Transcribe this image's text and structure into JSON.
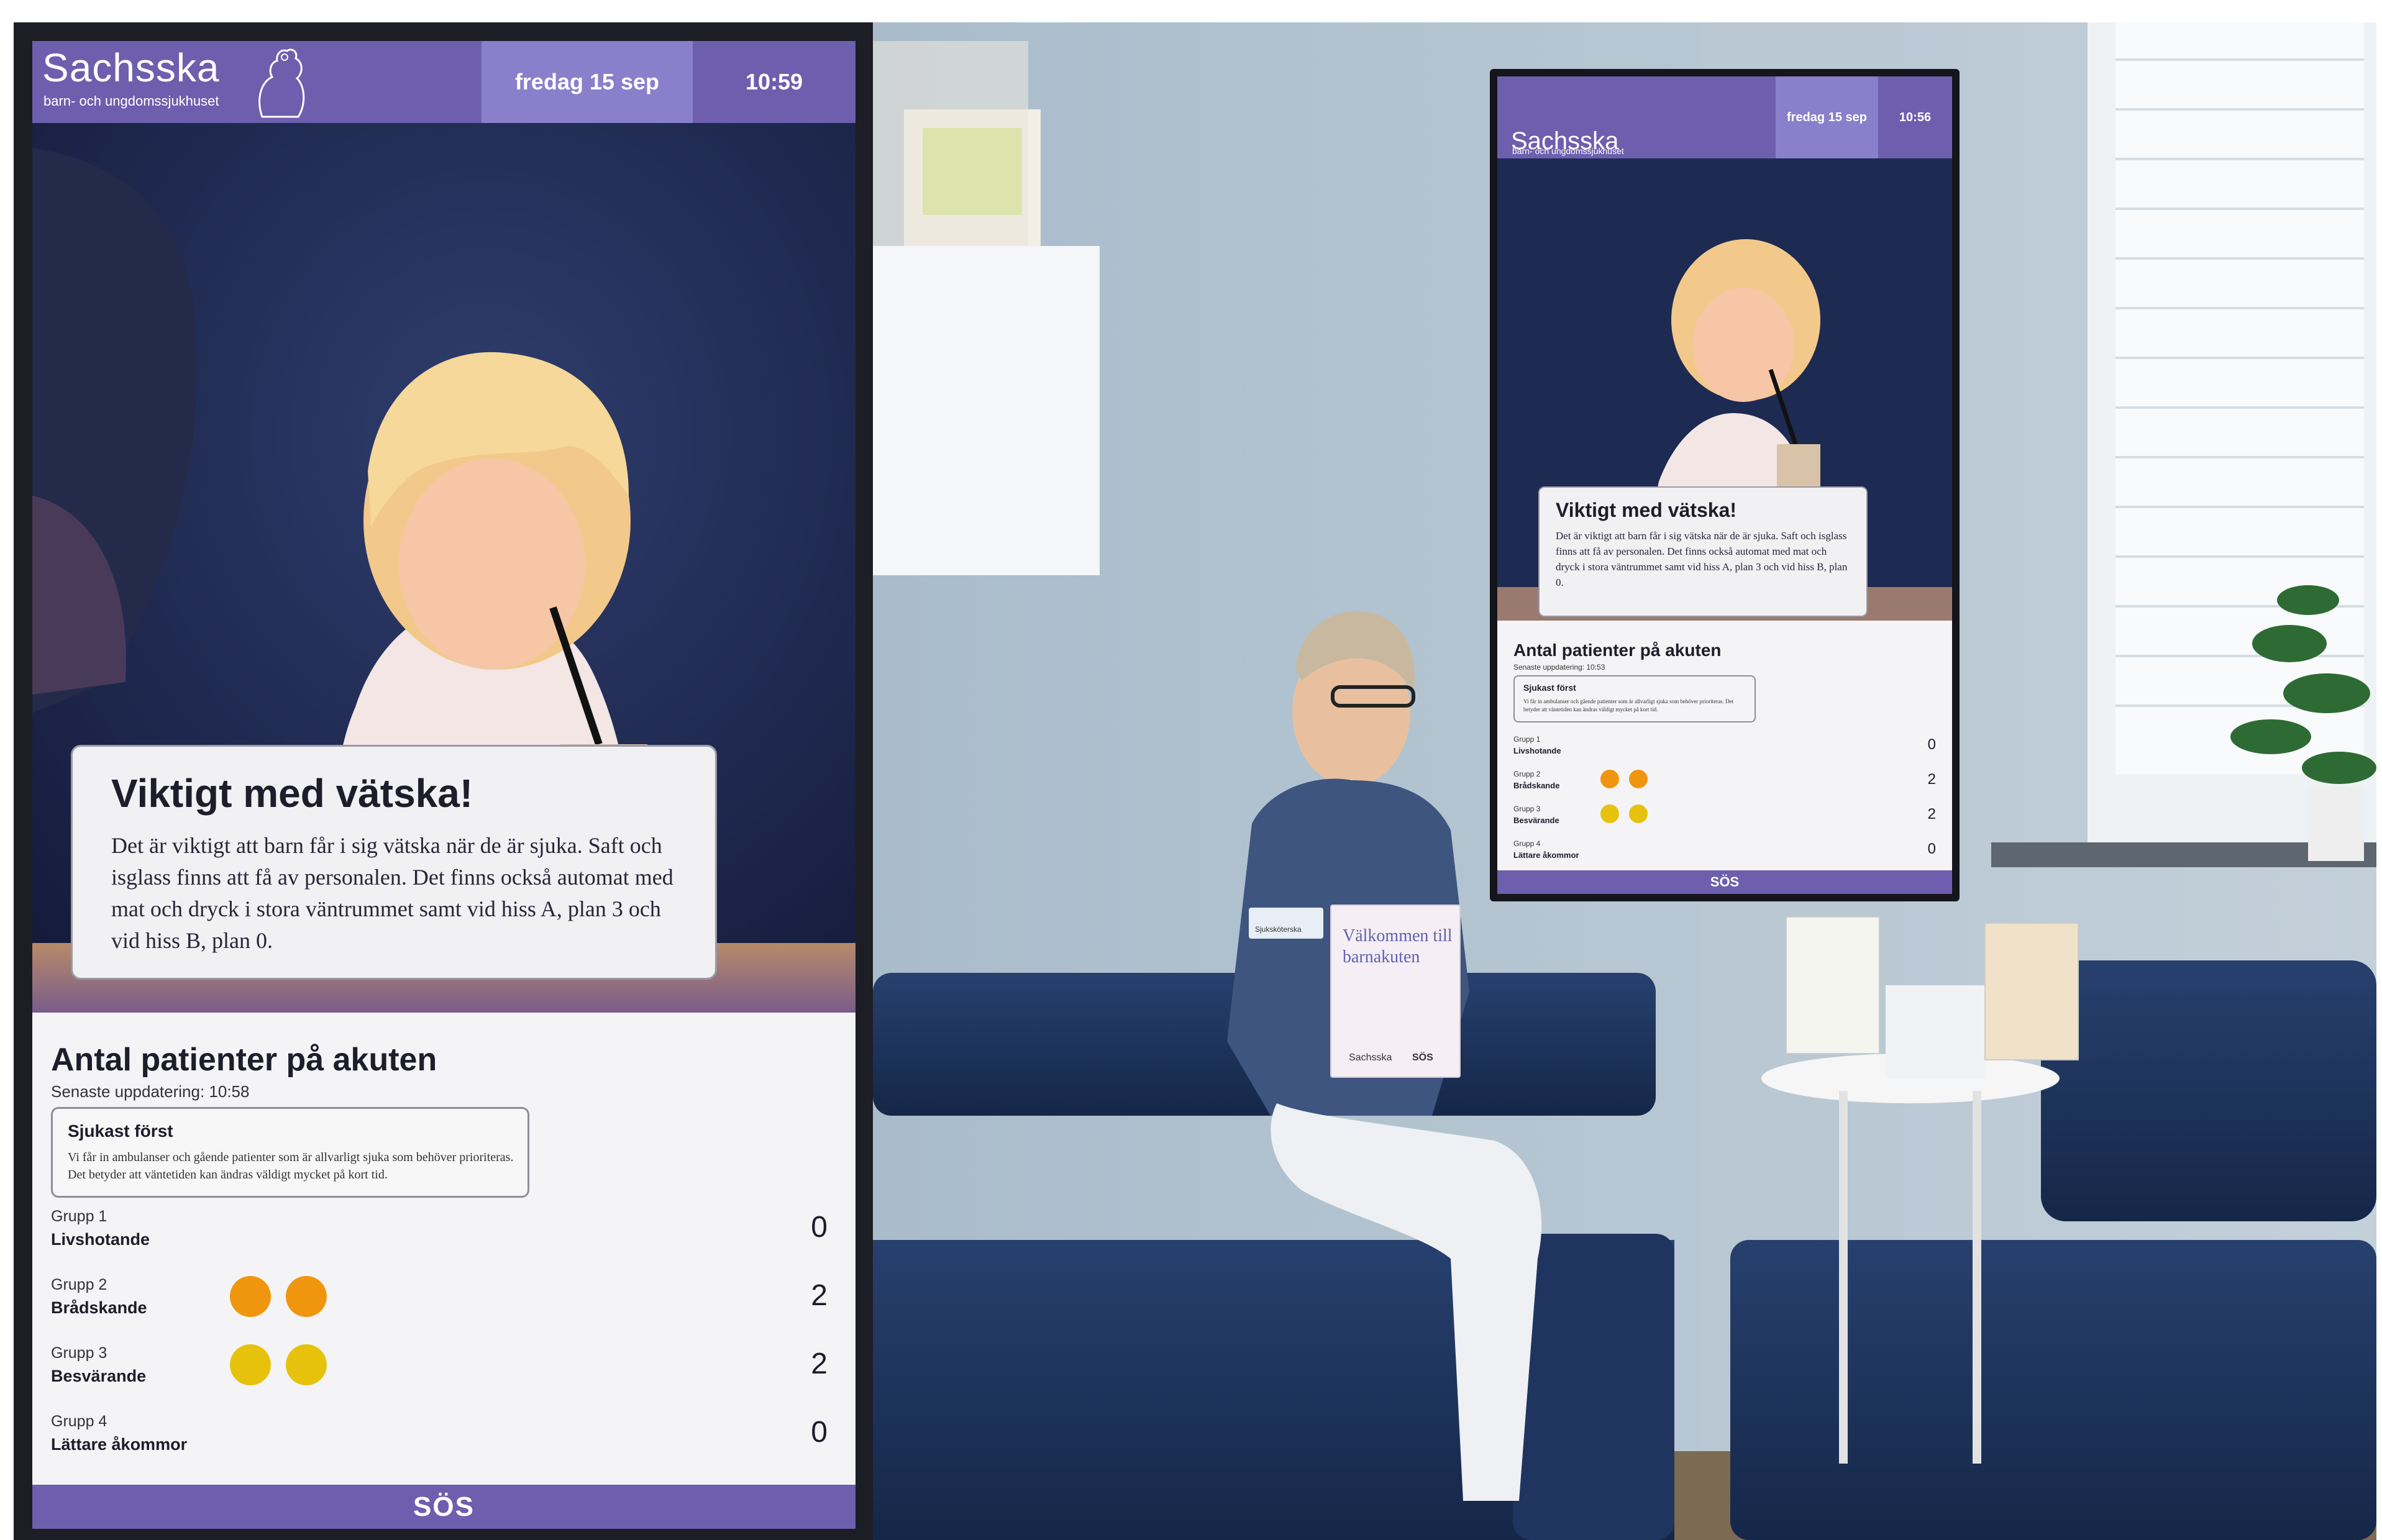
{
  "screen": {
    "brand": {
      "name": "Sachsska",
      "subtitle": "barn- och ungdomssjukhuset"
    },
    "date": "fredag 15 sep",
    "time": "10:59",
    "info": {
      "title": "Viktigt med vätska!",
      "text": "Det är viktigt att barn får i sig vätska när de är sjuka. Saft och isglass finns att få av personalen. Det finns också automat med mat och dryck i stora väntrummet samt vid hiss A, plan 3 och vid hiss B, plan 0."
    },
    "patients": {
      "title": "Antal patienter på akuten",
      "updated": "Senaste uppdatering: 10:58",
      "priority_title": "Sjukast först",
      "priority_text": "Vi får in ambulanser och gående patienter som är allvarligt sjuka som behöver prioriteras. Det betyder att väntetiden kan ändras väldigt mycket på kort tid.",
      "groups": [
        {
          "label": "Grupp 1",
          "name": "Livshotande",
          "count": "0",
          "dots": 0,
          "color": "#e8262b"
        },
        {
          "label": "Grupp 2",
          "name": "Brådskande",
          "count": "2",
          "dots": 2,
          "color": "#f0960e"
        },
        {
          "label": "Grupp 3",
          "name": "Besvärande",
          "count": "2",
          "dots": 2,
          "color": "#e6c20c"
        },
        {
          "label": "Grupp 4",
          "name": "Lättare åkommor",
          "count": "0",
          "dots": 0,
          "color": "#4caf50"
        }
      ]
    },
    "footer_logo": "SÖS"
  },
  "wall_screen": {
    "brand": "Sachsska",
    "subtitle": "barn- och ungdomssjukhuset",
    "date": "fredag 15 sep",
    "time": "10:56",
    "info_title": "Viktigt med vätska!",
    "info_text": "Det är viktigt att barn får i sig vätska när de är sjuka. Saft och isglass finns att få av personalen. Det finns också automat med mat och dryck i stora väntrummet samt vid hiss A, plan 3 och vid hiss B, plan 0.",
    "patients_title": "Antal patienter på akuten",
    "updated": "Senaste uppdatering: 10:53",
    "priority_title": "Sjukast först",
    "priority_text": "Vi får in ambulanser och gående patienter som är allvarligt sjuka som behöver prioriteras. Det betyder att väntetiden kan ändras väldigt mycket på kort tid.",
    "groups": [
      {
        "label": "Grupp 1",
        "name": "Livshotande",
        "count": "0"
      },
      {
        "label": "Grupp 2",
        "name": "Brådskande",
        "count": "2"
      },
      {
        "label": "Grupp 3",
        "name": "Besvärande",
        "count": "2"
      },
      {
        "label": "Grupp 4",
        "name": "Lättare åkommor",
        "count": "0"
      }
    ],
    "footer": "SÖS"
  },
  "booklet": {
    "title": "Välkommen till barnakuten",
    "brand": "Sachsska",
    "logo": "SÖS"
  },
  "badge": {
    "text": "Sjuksköterska"
  }
}
